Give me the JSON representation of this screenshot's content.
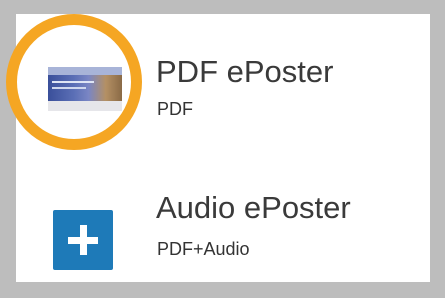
{
  "items": [
    {
      "title": "PDF ePoster",
      "subtitle": "PDF",
      "icon": "pdf-poster-thumbnail",
      "highlight_color": "#f5a623"
    },
    {
      "title": "Audio ePoster",
      "subtitle": "PDF+Audio",
      "icon": "plus-icon",
      "icon_color": "#1e7ab8"
    }
  ]
}
